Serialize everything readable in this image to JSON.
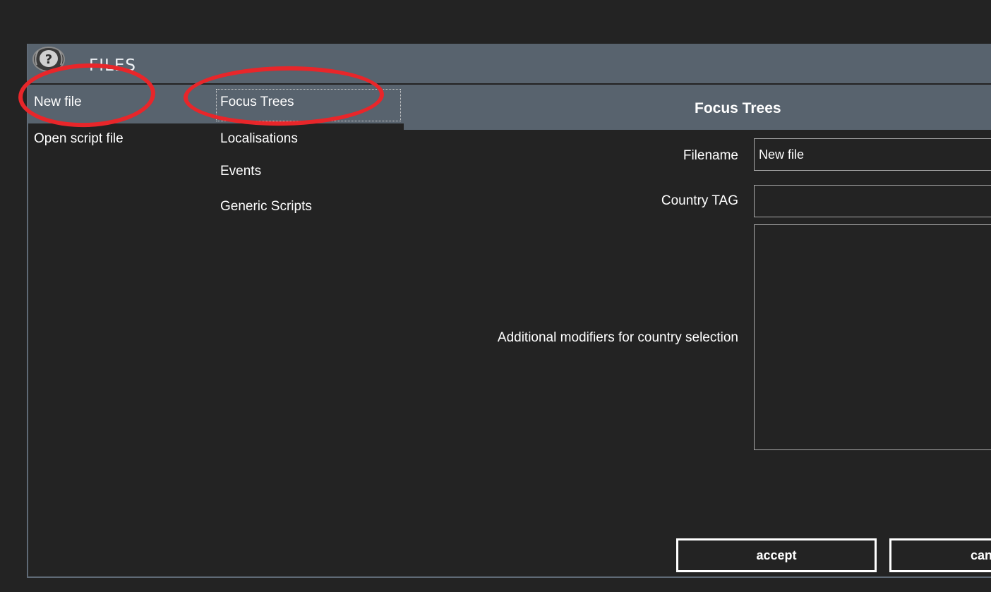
{
  "window": {
    "title": "FILES",
    "icon": "help-question-icon"
  },
  "col1": {
    "items": [
      {
        "label": "New file",
        "selected": true
      },
      {
        "label": "Open script file",
        "selected": false
      }
    ]
  },
  "col2": {
    "items": [
      {
        "label": "Focus Trees",
        "selected": true
      },
      {
        "label": "Localisations",
        "selected": false
      },
      {
        "label": "Events",
        "selected": false
      },
      {
        "label": "Generic Scripts",
        "selected": false
      }
    ]
  },
  "panel": {
    "title": "Focus Trees",
    "filename_label": "Filename",
    "filename_value": "New file",
    "tag_label": "Country TAG",
    "tag_value": "",
    "modifiers_label": "Additional modifiers for country selection",
    "modifiers_value": "",
    "accept_label": "accept",
    "cancel_label": "can"
  },
  "colors": {
    "background": "#232323",
    "header": "#58636e",
    "annotation": "#e8262a"
  }
}
